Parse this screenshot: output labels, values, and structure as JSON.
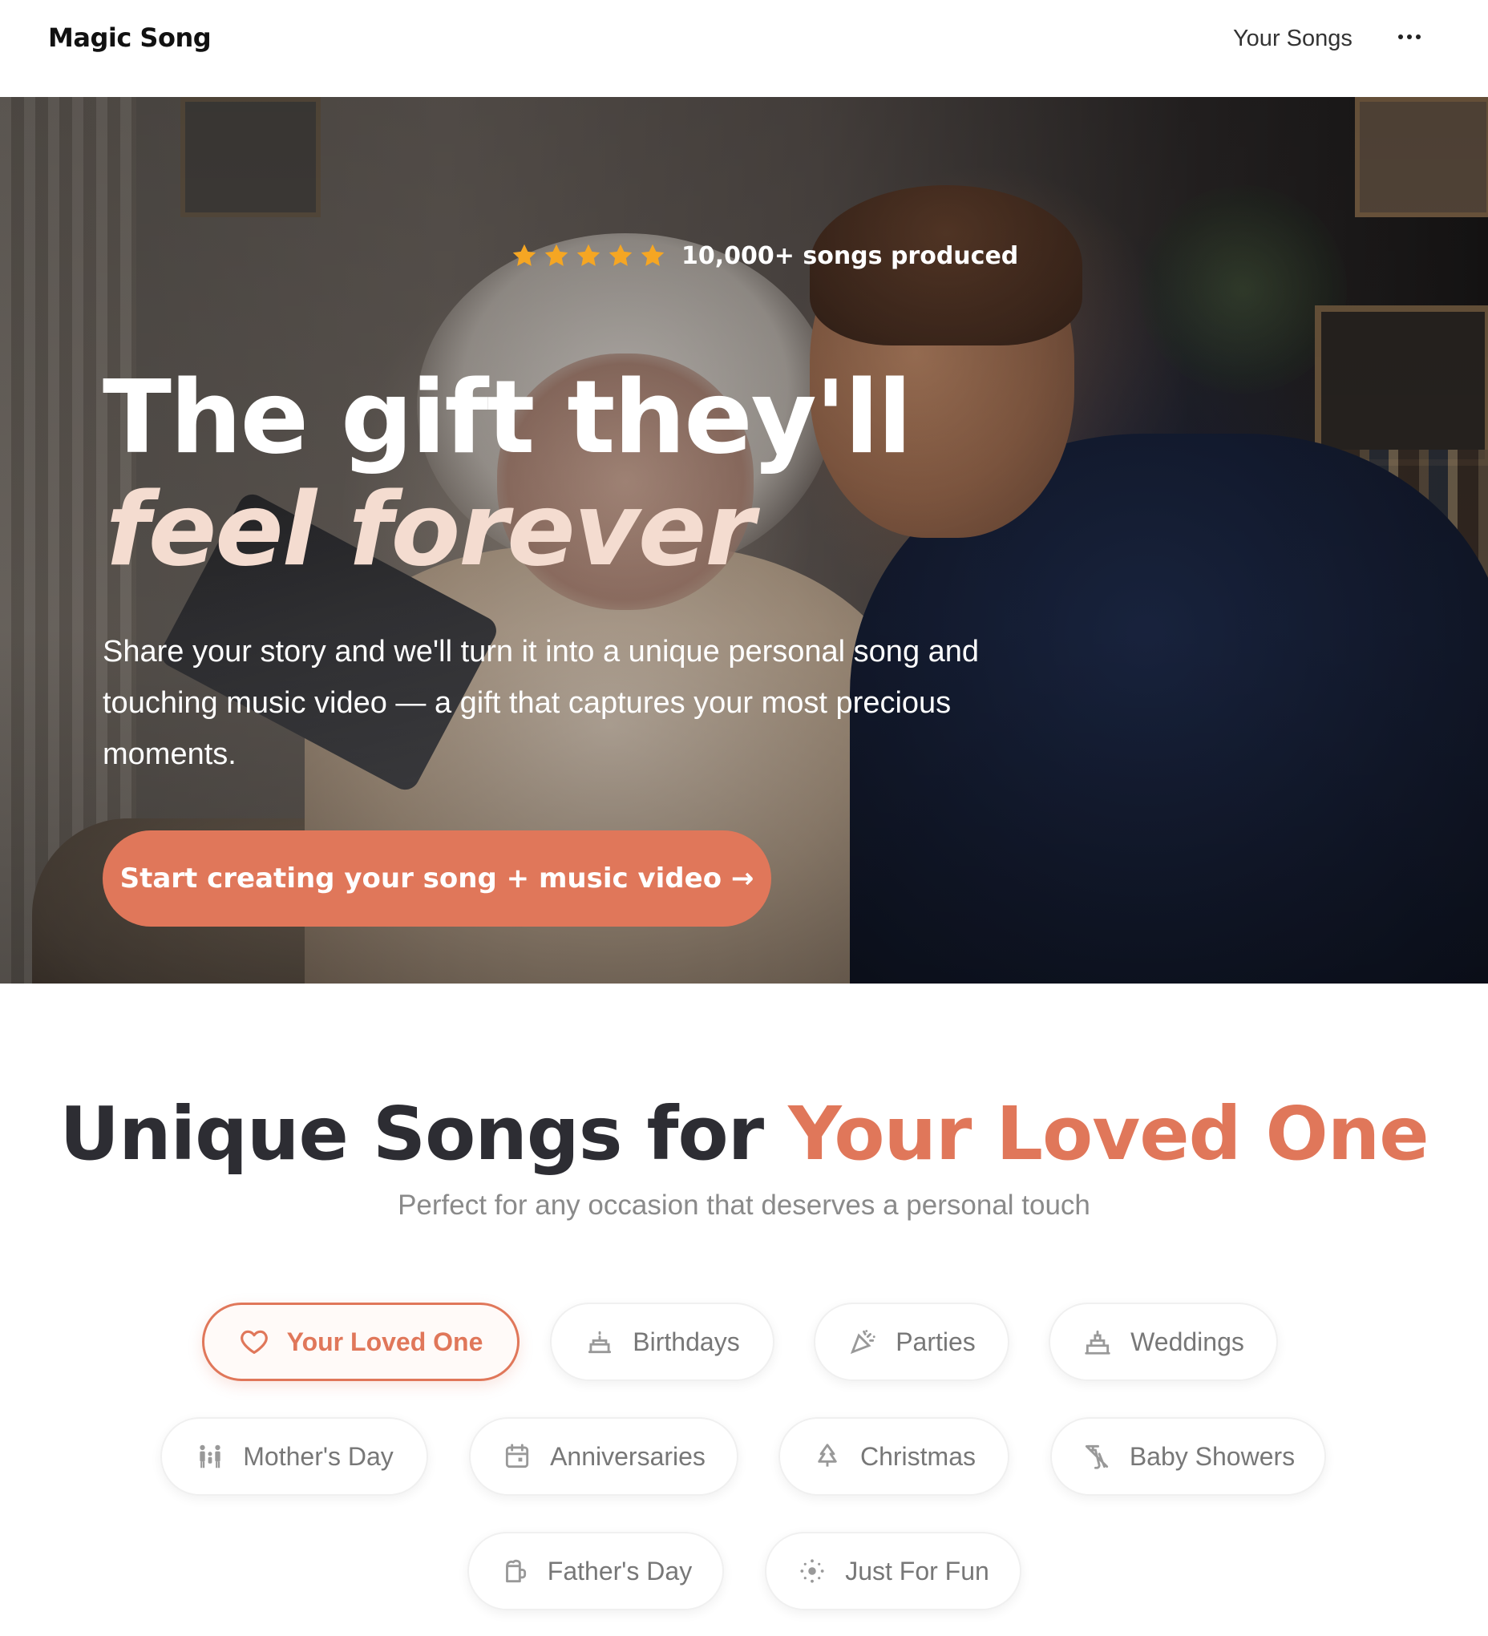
{
  "header": {
    "logo": "Magic Song",
    "nav_link": "Your Songs",
    "more_icon": "ellipsis-icon"
  },
  "hero": {
    "rating_text": "10,000+ songs produced",
    "star_count": 5,
    "star_color": "#f5a623",
    "headline_line1": "The gift they'll",
    "headline_line2": "feel forever",
    "description": "Share your story and we'll turn it into a unique personal song and touching music video — a gift that captures your most precious moments.",
    "cta_label": "Start creating your song + music video →",
    "accent_color": "#e0775a"
  },
  "section": {
    "title_start": "Unique Songs for ",
    "title_accent": "Your Loved One",
    "subtitle": "Perfect for any occasion that deserves a personal touch"
  },
  "occasions": [
    {
      "label": "Your Loved One",
      "icon": "heart-icon",
      "active": true
    },
    {
      "label": "Birthdays",
      "icon": "cake-icon",
      "active": false
    },
    {
      "label": "Parties",
      "icon": "party-popper-icon",
      "active": false
    },
    {
      "label": "Weddings",
      "icon": "wedding-cake-icon",
      "active": false
    },
    {
      "label": "Mother's Day",
      "icon": "family-icon",
      "active": false
    },
    {
      "label": "Anniversaries",
      "icon": "calendar-icon",
      "active": false
    },
    {
      "label": "Christmas",
      "icon": "christmas-tree-icon",
      "active": false
    },
    {
      "label": "Baby Showers",
      "icon": "baby-bottle-icon",
      "active": false
    },
    {
      "label": "Father's Day",
      "icon": "beer-mug-icon",
      "active": false
    },
    {
      "label": "Just For Fun",
      "icon": "sparkles-icon",
      "active": false
    }
  ]
}
